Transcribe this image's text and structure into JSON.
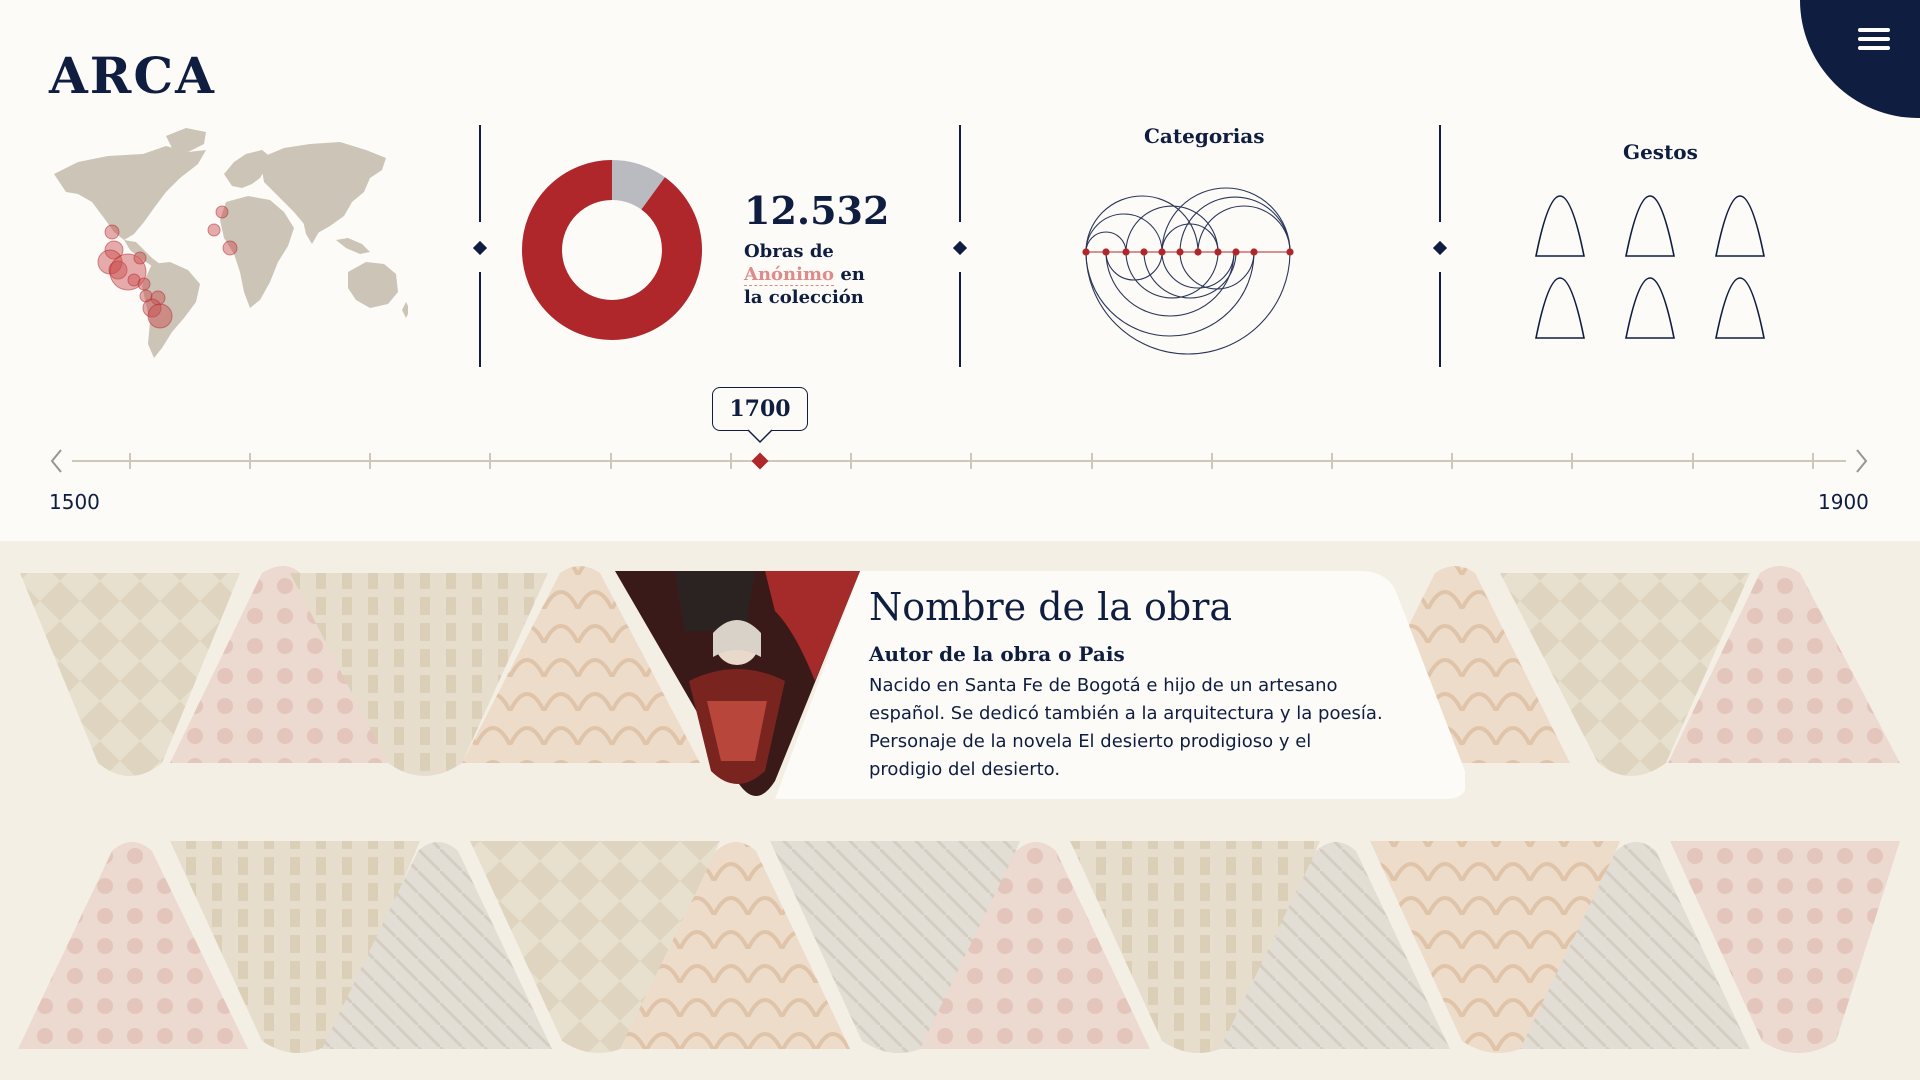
{
  "header": {
    "logo": "ARCA",
    "menu_icon": "hamburger-icon"
  },
  "colors": {
    "navy": "#0f1d40",
    "red": "#b0272b",
    "grey": "#babbc0",
    "map": "#ccc4b6",
    "accent_pink": "#e08a8a",
    "background": "#fcfbf7",
    "gallery_bg": "#f4efe5"
  },
  "stats": {
    "count": "12.532",
    "line1": "Obras de",
    "author": "Anónimo",
    "author_suffix": " en",
    "line3": "la colección",
    "donut": {
      "share": 0.9,
      "highlight_color": "#b0272b",
      "rest_color": "#babbc0"
    }
  },
  "categories": {
    "title": "Categorias"
  },
  "gestures": {
    "title": "Gestos",
    "icon": "triangle-icon",
    "count": 6
  },
  "timeline": {
    "start": "1500",
    "end": "1900",
    "selected": "1700"
  },
  "card": {
    "title": "Nombre de la obra",
    "author": "Autor de la obra o Pais",
    "description": "Nacido en Santa Fe de Bogotá e hijo de un artesano español. Se dedicó también a la arquitectura y la poesía. Personaje de la novela El desierto prodigioso y el prodigio del desierto."
  }
}
